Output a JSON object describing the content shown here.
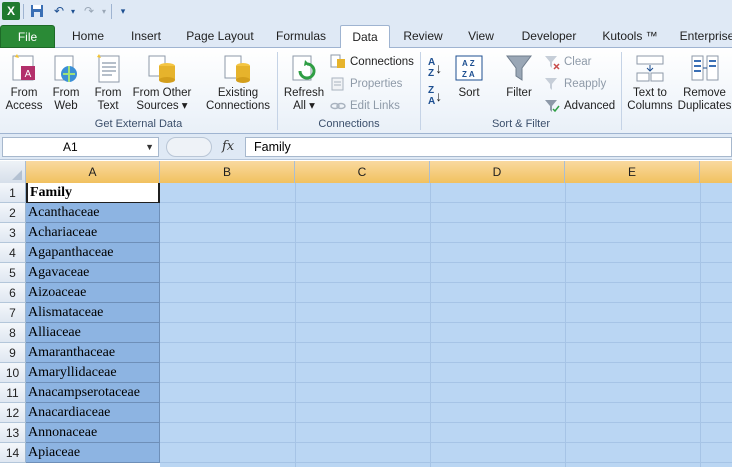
{
  "quick_access": {
    "items": [
      "excel-logo-icon",
      "save-icon",
      "undo-icon",
      "redo-icon",
      "customize-icon"
    ]
  },
  "tabs": [
    {
      "label": "File"
    },
    {
      "label": "Home"
    },
    {
      "label": "Insert"
    },
    {
      "label": "Page Layout"
    },
    {
      "label": "Formulas"
    },
    {
      "label": "Data"
    },
    {
      "label": "Review"
    },
    {
      "label": "View"
    },
    {
      "label": "Developer"
    },
    {
      "label": "Kutools ™"
    },
    {
      "label": "Enterprise"
    }
  ],
  "active_tab": "Data",
  "ribbon": {
    "get_external": {
      "label": "Get External Data",
      "from_access": "From Access",
      "from_access_1": "From",
      "from_access_2": "Access",
      "from_web_1": "From",
      "from_web_2": "Web",
      "from_text_1": "From",
      "from_text_2": "Text",
      "from_other_1": "From Other",
      "from_other_2": "Sources ▾",
      "existing_1": "Existing",
      "existing_2": "Connections"
    },
    "connections": {
      "label": "Connections",
      "refresh_1": "Refresh",
      "refresh_2": "All ▾",
      "connections": "Connections",
      "properties": "Properties",
      "edit_links": "Edit Links"
    },
    "sort_filter": {
      "label": "Sort & Filter",
      "sort": "Sort",
      "filter": "Filter",
      "clear": "Clear",
      "reapply": "Reapply",
      "advanced": "Advanced"
    },
    "data_tools": {
      "text_to_columns_1": "Text to",
      "text_to_columns_2": "Columns",
      "remove_dup_1": "Remove",
      "remove_dup_2": "Duplicates"
    }
  },
  "formula_bar": {
    "name_box": "A1",
    "fx": "fx",
    "formula": "Family"
  },
  "columns": [
    "A",
    "B",
    "C",
    "D",
    "E"
  ],
  "rows": [
    {
      "num": "1",
      "a": "Family"
    },
    {
      "num": "2",
      "a": "Acanthaceae"
    },
    {
      "num": "3",
      "a": "Achariaceae"
    },
    {
      "num": "4",
      "a": "Agapanthaceae"
    },
    {
      "num": "5",
      "a": "Agavaceae"
    },
    {
      "num": "6",
      "a": "Aizoaceae"
    },
    {
      "num": "7",
      "a": "Alismataceae"
    },
    {
      "num": "8",
      "a": "Alliaceae"
    },
    {
      "num": "9",
      "a": "Amaranthaceae"
    },
    {
      "num": "10",
      "a": "Amaryllidaceae"
    },
    {
      "num": "11",
      "a": "Anacampserotaceae"
    },
    {
      "num": "12",
      "a": "Anacardiaceae"
    },
    {
      "num": "13",
      "a": "Annonaceae"
    },
    {
      "num": "14",
      "a": "Apiaceae"
    }
  ],
  "colors": {
    "file_tab": "#2a8a36",
    "selection": "#bad6f3",
    "column_a_fill": "#8db4e2",
    "header_selected": "#f1c15f"
  }
}
